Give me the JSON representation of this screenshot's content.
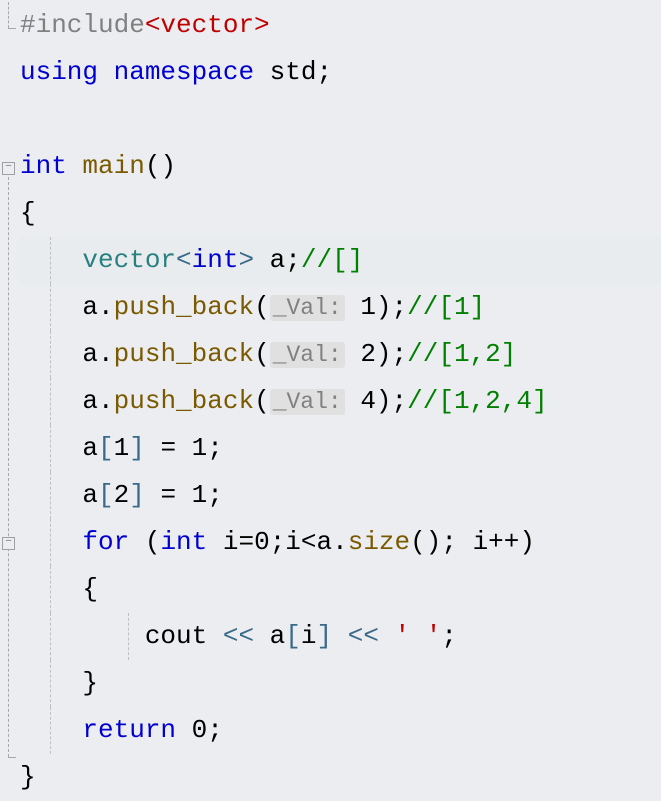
{
  "code": {
    "l1": {
      "preproc": "#include",
      "header": "<vector>"
    },
    "l2": {
      "kw1": "using",
      "kw2": "namespace",
      "ns": "std",
      "semi": ";"
    },
    "l4": {
      "type": "int",
      "fn": "main",
      "paren": "()"
    },
    "l5": {
      "brace": "{"
    },
    "l6": {
      "cls": "vector",
      "lt": "<",
      "tp": "int",
      "gt": ">",
      "var": " a",
      "semi": ";",
      "cmt": "//[]"
    },
    "l7": {
      "obj": "a",
      "dot": ".",
      "fn": "push_back",
      "lp": "(",
      "hint": "_Val:",
      "sp": " ",
      "arg": "1",
      "rp": ")",
      "semi": ";",
      "cmt": "//[1]"
    },
    "l8": {
      "obj": "a",
      "dot": ".",
      "fn": "push_back",
      "lp": "(",
      "hint": "_Val:",
      "sp": " ",
      "arg": "2",
      "rp": ")",
      "semi": ";",
      "cmt": "//[1,2]"
    },
    "l9": {
      "obj": "a",
      "dot": ".",
      "fn": "push_back",
      "lp": "(",
      "hint": "_Val:",
      "sp": " ",
      "arg": "4",
      "rp": ")",
      "semi": ";",
      "cmt": "//[1,2,4]"
    },
    "l10": {
      "obj": "a",
      "lb": "[",
      "idx": "1",
      "rb": "]",
      "eq": " = ",
      "val": "1",
      "semi": ";"
    },
    "l11": {
      "obj": "a",
      "lb": "[",
      "idx": "2",
      "rb": "]",
      "eq": " = ",
      "val": "1",
      "semi": ";"
    },
    "l12": {
      "kw": "for",
      "lp": " (",
      "tp": "int",
      "init": " i=",
      "zero": "0",
      "semi1": ";",
      "cond1": "i<a.",
      "sz": "size",
      "paren": "()",
      "semi2": ";",
      "inc": " i++",
      "rp": ")"
    },
    "l13": {
      "brace": "{"
    },
    "l14": {
      "cout": "cout",
      "op1": " << ",
      "obj": "a",
      "lb": "[",
      "idx": "i",
      "rb": "]",
      "op2": " << ",
      "ch": "' '",
      "semi": ";"
    },
    "l15": {
      "brace": "}"
    },
    "l16": {
      "kw": "return",
      "val": " 0",
      "semi": ";"
    },
    "l17": {
      "brace": "}"
    }
  }
}
